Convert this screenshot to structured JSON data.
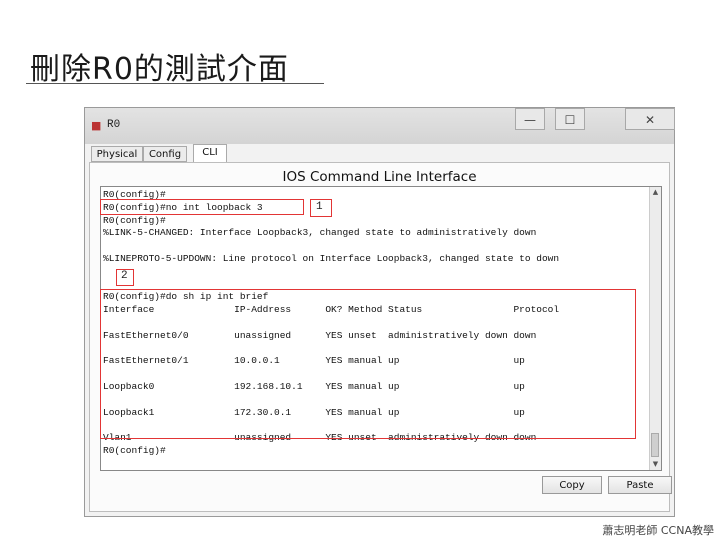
{
  "slide": {
    "title": "刪除R0的測試介面",
    "footer": "蕭志明老師 CCNA教學"
  },
  "window": {
    "icon": "router-icon",
    "title": "R0",
    "minimize_label": "—",
    "maximize_label": "☐",
    "close_label": "✕"
  },
  "tabs": [
    {
      "label": "Physical"
    },
    {
      "label": "Config"
    },
    {
      "label": "CLI",
      "active": true
    }
  ],
  "panel": {
    "heading": "IOS Command Line Interface"
  },
  "terminal": {
    "lines": [
      "R0(config)#",
      "R0(config)#no int loopback 3",
      "R0(config)#",
      "%LINK-5-CHANGED: Interface Loopback3, changed state to administratively down",
      "",
      "%LINEPROTO-5-UPDOWN: Line protocol on Interface Loopback3, changed state to down",
      "",
      "",
      "R0(config)#do sh ip int brief",
      "Interface              IP-Address      OK? Method Status                Protocol",
      "",
      "FastEthernet0/0        unassigned      YES unset  administratively down down",
      "",
      "FastEthernet0/1        10.0.0.1        YES manual up                    up",
      "",
      "Loopback0              192.168.10.1    YES manual up                    up",
      "",
      "Loopback1              172.30.0.1      YES manual up                    up",
      "",
      "Vlan1                  unassigned      YES unset  administratively down down",
      "R0(config)#"
    ]
  },
  "annotations": {
    "marker1": "1",
    "marker2": "2"
  },
  "buttons": {
    "copy": "Copy",
    "paste": "Paste"
  },
  "colors": {
    "highlight": "#e23535"
  }
}
